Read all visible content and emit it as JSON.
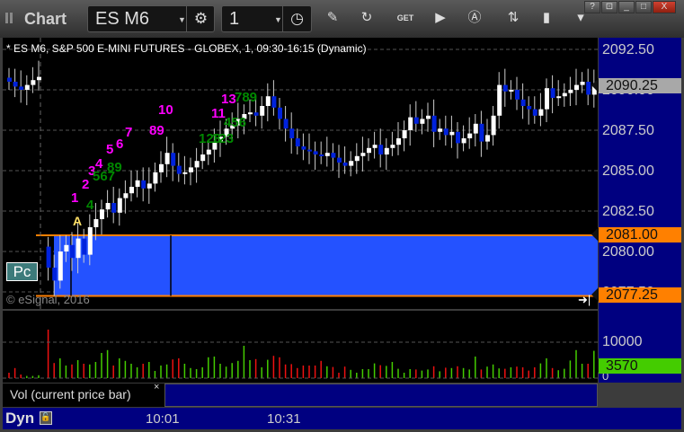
{
  "window": {
    "title": "Chart",
    "symbol": "ES M6",
    "interval": "1",
    "buttons": [
      "?",
      "window-menu",
      "_",
      "□",
      "X"
    ]
  },
  "chart": {
    "description": "* ES M6, S&P 500 E-MINI FUTURES - GLOBEX, 1, 09:30-16:15 (Dynamic)",
    "copyright": "© eSignal, 2016",
    "pc_label": "Pc",
    "range_marker": "A",
    "price_labels": [
      "2092.50",
      "2090.00",
      "2087.50",
      "2085.00",
      "2082.50",
      "2080.00",
      "2077.50"
    ],
    "last_price": "2090.25",
    "range_high": "2081.00",
    "range_low": "2077.25",
    "colors": {
      "up": "#ffffff",
      "down": "#0022dd",
      "range_fill": "#2452ff",
      "range_line": "#ff8000",
      "axis_bg": "#000080"
    },
    "annotations": [
      {
        "text": "1",
        "color": "#ff00ff"
      },
      {
        "text": "2",
        "color": "#ff00ff"
      },
      {
        "text": "3",
        "color": "#ff00ff"
      },
      {
        "text": "4",
        "color": "#ff00ff"
      },
      {
        "text": "5",
        "color": "#ff00ff"
      },
      {
        "text": "6",
        "color": "#ff00ff"
      },
      {
        "text": "7",
        "color": "#ff00ff"
      },
      {
        "text": "89",
        "color": "#ff00ff"
      },
      {
        "text": "10",
        "color": "#ff00ff"
      },
      {
        "text": "11",
        "color": "#ff00ff"
      },
      {
        "text": "13",
        "color": "#ff00ff"
      },
      {
        "text": "123",
        "color": "#008800"
      },
      {
        "text": "4",
        "color": "#008800"
      },
      {
        "text": "567",
        "color": "#008800"
      },
      {
        "text": "89",
        "color": "#008800"
      },
      {
        "text": "123",
        "color": "#008800"
      },
      {
        "text": "456",
        "color": "#008800"
      },
      {
        "text": "789",
        "color": "#008800"
      }
    ]
  },
  "chart_data": {
    "type": "candlestick",
    "closes": [
      2090.5,
      2090.2,
      2090.0,
      2090.3,
      2090.6,
      2090.8,
      2079.0,
      2078.2,
      2080.0,
      2080.4,
      2079.6,
      2080.8,
      2079.8,
      2081.5,
      2082.0,
      2082.6,
      2083.0,
      2082.4,
      2083.3,
      2083.6,
      2084.0,
      2084.4,
      2083.9,
      2084.2,
      2084.9,
      2085.4,
      2086.1,
      2085.3,
      2084.8,
      2084.9,
      2085.2,
      2085.6,
      2086.0,
      2086.3,
      2086.8,
      2087.1,
      2087.6,
      2087.8,
      2088.2,
      2088.5,
      2088.6,
      2088.4,
      2089.0,
      2089.6,
      2088.9,
      2088.2,
      2087.6,
      2087.0,
      2086.5,
      2086.3,
      2086.2,
      2086.0,
      2085.9,
      2086.1,
      2085.8,
      2085.5,
      2085.3,
      2085.6,
      2085.9,
      2086.1,
      2086.4,
      2086.6,
      2086.0,
      2086.4,
      2086.6,
      2087.0,
      2087.5,
      2088.3,
      2087.9,
      2088.2,
      2088.4,
      2087.4,
      2087.6,
      2087.2,
      2087.4,
      2086.7,
      2087.0,
      2087.3,
      2087.9,
      2086.8,
      2087.2,
      2088.4,
      2090.3,
      2089.9,
      2090.0,
      2089.4,
      2089.0,
      2088.8,
      2088.4,
      2088.8,
      2090.1,
      2089.5,
      2089.6,
      2089.8,
      2090.0,
      2090.3,
      2090.5,
      2089.7,
      2090.25
    ],
    "volume": [
      1500,
      2800,
      1000,
      600,
      600,
      800,
      13500,
      4200,
      5500,
      3500,
      3800,
      5000,
      4000,
      3800,
      4500,
      7000,
      7800,
      3500,
      5500,
      4800,
      4000,
      3000,
      4000,
      4500,
      2000,
      3500,
      3800,
      5200,
      5500,
      4000,
      2800,
      2500,
      3000,
      5800,
      6000,
      4000,
      3200,
      4200,
      4800,
      9000,
      5000,
      5300,
      3000,
      5100,
      6200,
      5800,
      3800,
      3900,
      2800,
      3500,
      3500,
      3500,
      4800,
      3300,
      3100,
      1500,
      3200,
      2300,
      1500,
      2500,
      2500,
      4100,
      3600,
      3400,
      4500,
      2600,
      1500,
      2500,
      2400,
      2100,
      2400,
      3300,
      1900,
      2900,
      2800,
      3300,
      2800,
      2400,
      6000,
      2400,
      3200,
      3800,
      2700,
      2600,
      3000,
      3200,
      3000,
      2100,
      3000,
      4100,
      5500,
      2800,
      2200,
      2600,
      4900,
      7800,
      4000,
      4000,
      7600,
      3570
    ],
    "volume_labels": {
      "max": "10000",
      "zero": "0",
      "current": "3570"
    },
    "ylim": [
      2076.5,
      2093.5
    ]
  },
  "volume_pane": {
    "legend": "Vol (current price bar)",
    "close": "×"
  },
  "time_axis": {
    "mode": "Dyn",
    "labels": [
      "10:01",
      "10:31"
    ]
  }
}
